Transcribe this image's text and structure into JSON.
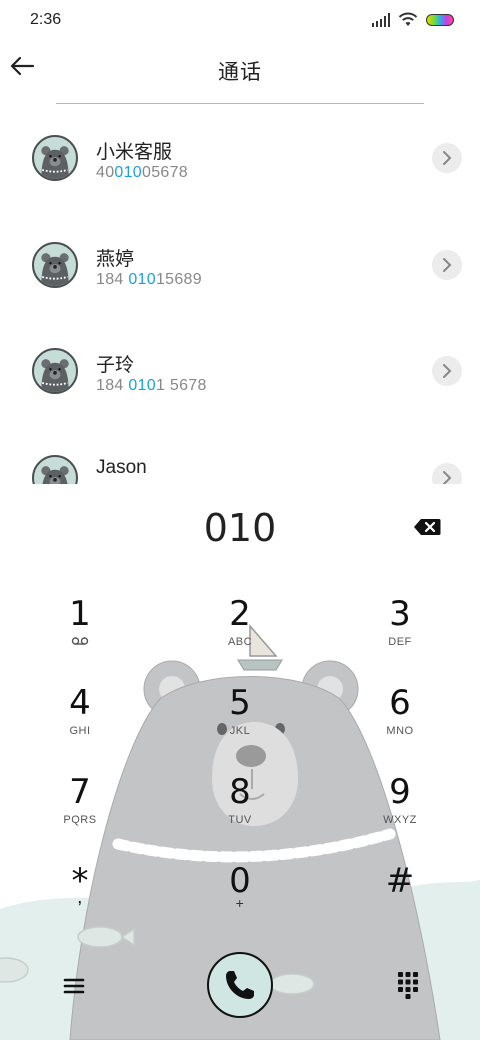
{
  "status_bar": {
    "time": "2:36",
    "icons": [
      "signal-icon",
      "wifi-icon",
      "battery-icon"
    ]
  },
  "header": {
    "title": "通话",
    "back_icon": "arrow-left-icon"
  },
  "contacts": [
    {
      "name": "小米客服",
      "number_prefix": "40",
      "number_match": "010",
      "number_suffix": "05678"
    },
    {
      "name": "燕婷",
      "number_prefix": "184 ",
      "number_match": "010",
      "number_suffix": "15689"
    },
    {
      "name": "子玲",
      "number_prefix": "184 ",
      "number_match": "010",
      "number_suffix": "1 5678"
    },
    {
      "name": "Jason",
      "number_prefix": "",
      "number_match": "",
      "number_suffix": ""
    }
  ],
  "dialer": {
    "input": "010",
    "keys": [
      {
        "digit": "1",
        "letters": ""
      },
      {
        "digit": "2",
        "letters": "ABC"
      },
      {
        "digit": "3",
        "letters": "DEF"
      },
      {
        "digit": "4",
        "letters": "GHI"
      },
      {
        "digit": "5",
        "letters": "JKL"
      },
      {
        "digit": "6",
        "letters": "MNO"
      },
      {
        "digit": "7",
        "letters": "PQRS"
      },
      {
        "digit": "8",
        "letters": "TUV"
      },
      {
        "digit": "9",
        "letters": "WXYZ"
      },
      {
        "digit": "*",
        "letters": ","
      },
      {
        "digit": "0",
        "letters": "+"
      },
      {
        "digit": "#",
        "letters": ""
      }
    ]
  },
  "colors": {
    "accent": "#1da0e0",
    "call_button_bg": "#cfe6e2",
    "bear_gray": "#c2c4c6",
    "water": "#e3efec"
  }
}
